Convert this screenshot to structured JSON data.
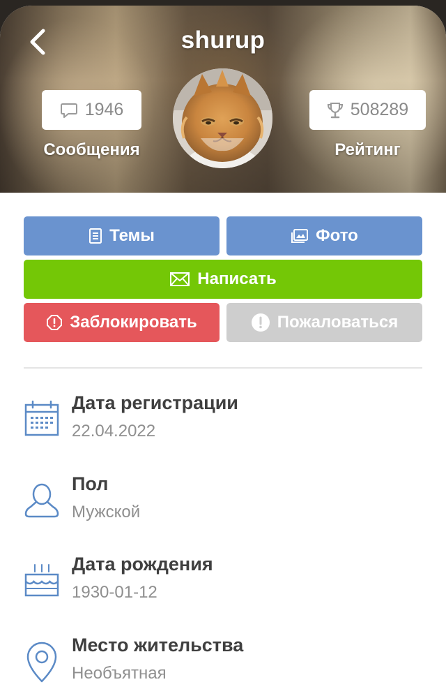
{
  "profile": {
    "username": "shurup",
    "messages_count": "1946",
    "messages_label": "Сообщения",
    "rating_value": "508289",
    "rating_label": "Рейтинг"
  },
  "actions": {
    "topics_label": "Темы",
    "photo_label": "Фото",
    "write_label": "Написать",
    "block_label": "Заблокировать",
    "report_label": "Пожаловаться"
  },
  "info": [
    {
      "label": "Дата регистрации",
      "value": "22.04.2022",
      "icon": "calendar-icon"
    },
    {
      "label": "Пол",
      "value": "Мужской",
      "icon": "person-icon"
    },
    {
      "label": "Дата рождения",
      "value": "1930-01-12",
      "icon": "cake-icon"
    },
    {
      "label": "Место жительства",
      "value": "Необъятная",
      "icon": "location-pin-icon"
    }
  ],
  "colors": {
    "primary_blue": "#6a93cf",
    "write_green": "#74c706",
    "block_red": "#e5575b",
    "report_gray": "#cecece",
    "icon_blue": "#5b8ac6"
  }
}
